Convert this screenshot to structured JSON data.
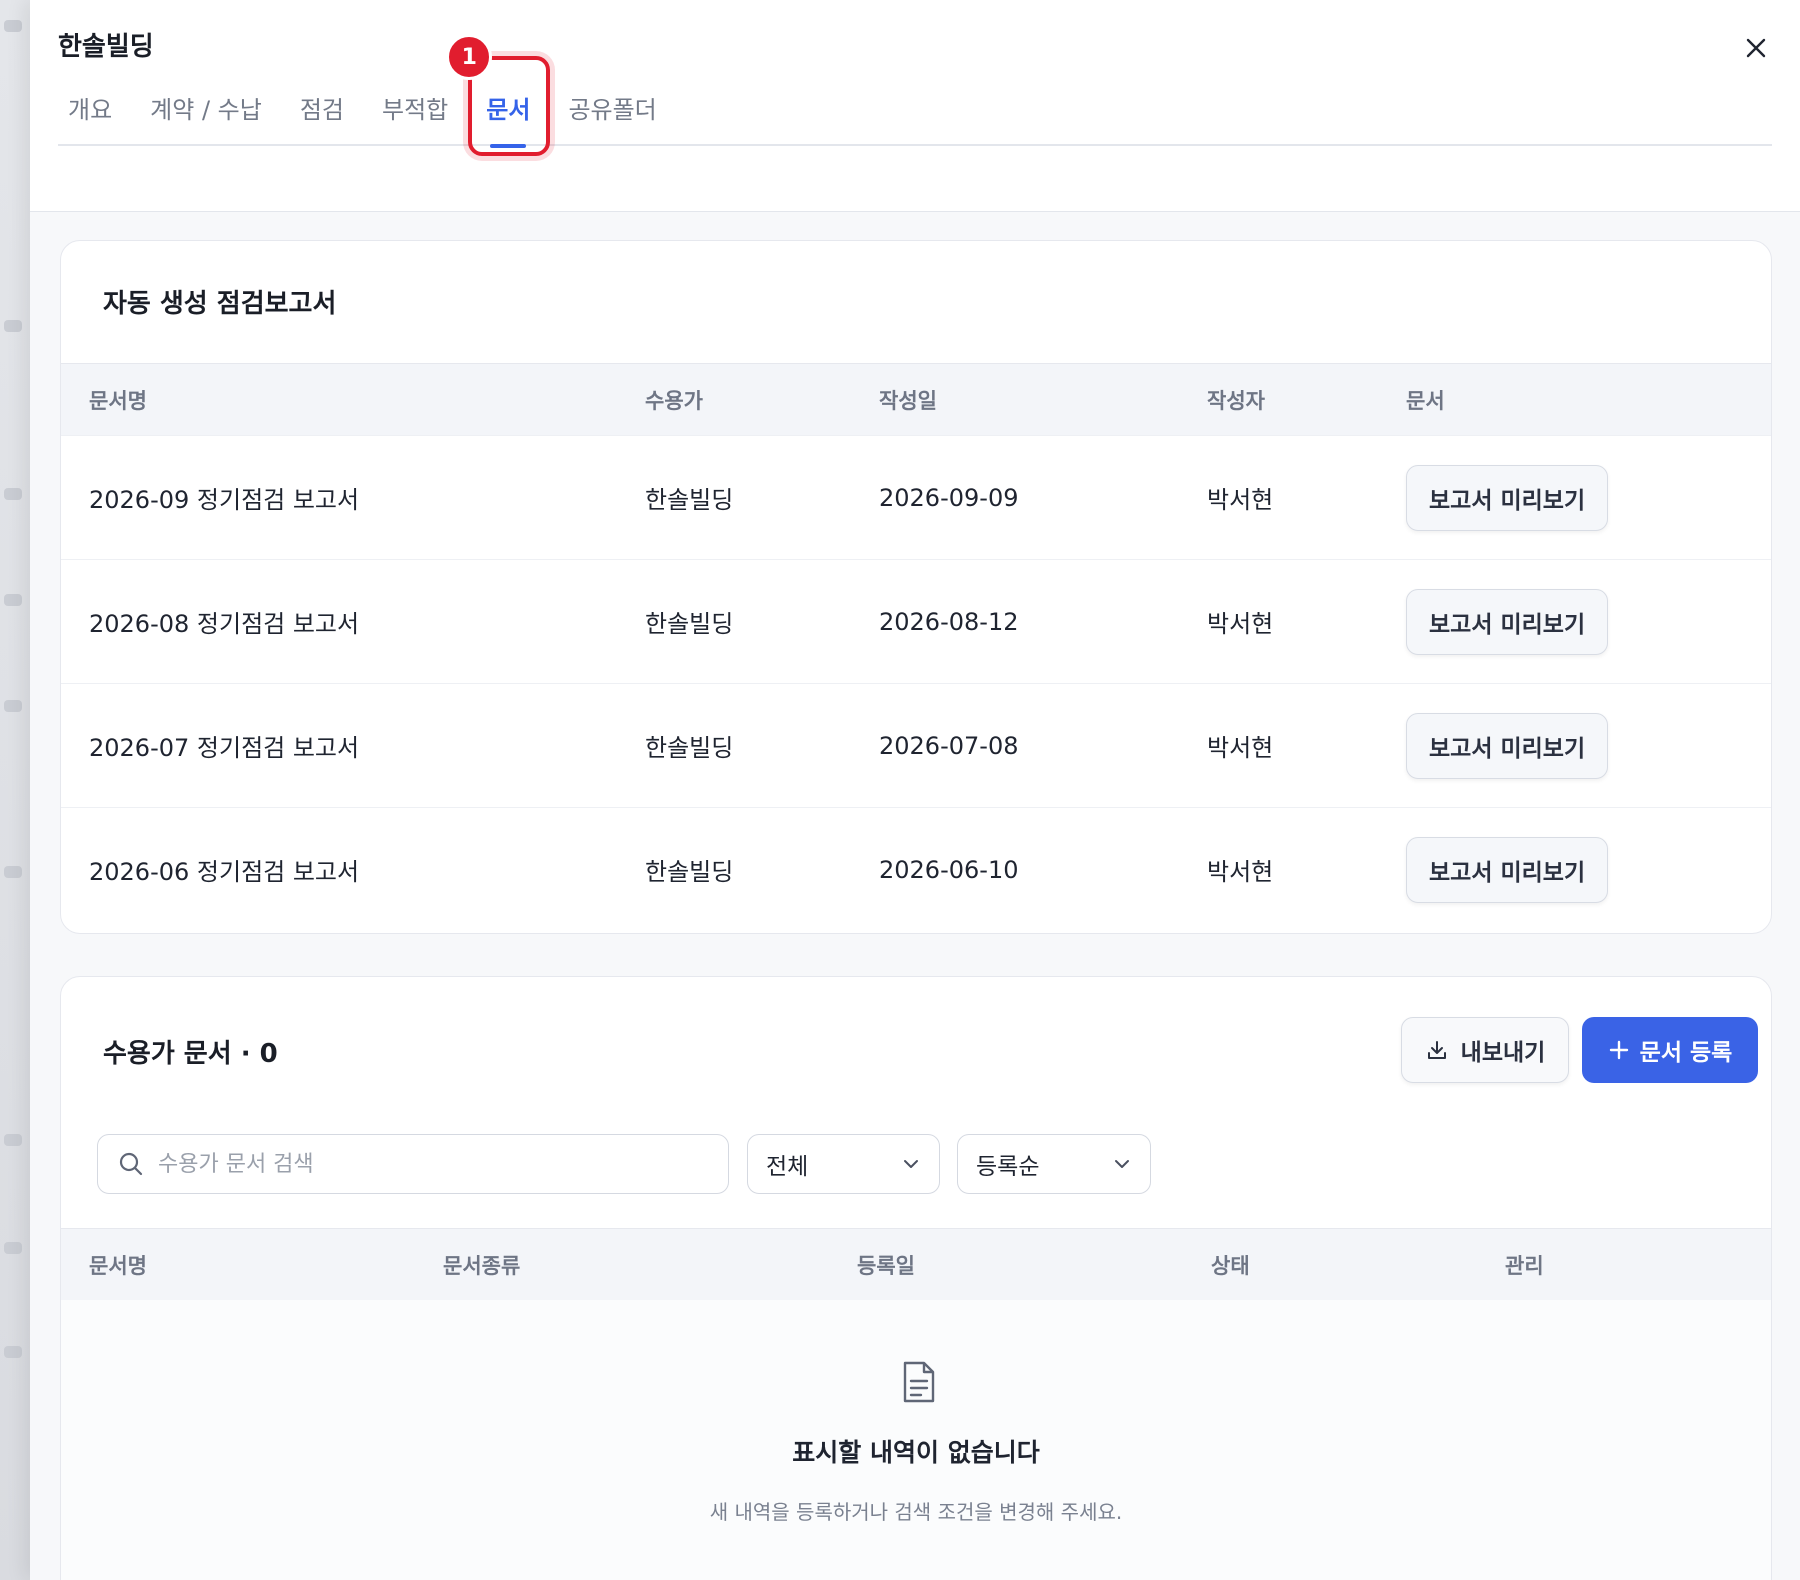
{
  "header": {
    "title": "한솔빌딩",
    "tabs": [
      {
        "label": "개요"
      },
      {
        "label": "계약 / 수납"
      },
      {
        "label": "점검"
      },
      {
        "label": "부적합"
      },
      {
        "label": "문서",
        "active": true
      },
      {
        "label": "공유폴더"
      }
    ],
    "step_badge": "1"
  },
  "report_section": {
    "title": "자동 생성 점검보고서",
    "columns": [
      "문서명",
      "수용가",
      "작성일",
      "작성자",
      "문서"
    ],
    "rows": [
      {
        "name": "2026-09 정기점검 보고서",
        "customer": "한솔빌딩",
        "date": "2026-09-09",
        "author": "박서현",
        "action": "보고서 미리보기"
      },
      {
        "name": "2026-08 정기점검 보고서",
        "customer": "한솔빌딩",
        "date": "2026-08-12",
        "author": "박서현",
        "action": "보고서 미리보기"
      },
      {
        "name": "2026-07 정기점검 보고서",
        "customer": "한솔빌딩",
        "date": "2026-07-08",
        "author": "박서현",
        "action": "보고서 미리보기"
      },
      {
        "name": "2026-06 정기점검 보고서",
        "customer": "한솔빌딩",
        "date": "2026-06-10",
        "author": "박서현",
        "action": "보고서 미리보기"
      }
    ]
  },
  "customer_docs": {
    "title": "수용가 문서 · 0",
    "export_label": "내보내기",
    "add_label": "문서 등록",
    "search_placeholder": "수용가 문서 검색",
    "filter_selected": "전체",
    "sort_selected": "등록순",
    "columns": [
      "문서명",
      "문서종류",
      "등록일",
      "상태",
      "관리"
    ],
    "empty_title": "표시할 내역이 없습니다",
    "empty_desc": "새 내역을 등록하거나 검색 조건을 변경해 주세요."
  },
  "colors": {
    "accent": "#3563e9",
    "highlight": "#e11d2e",
    "primary_button": "#3a63e6"
  }
}
